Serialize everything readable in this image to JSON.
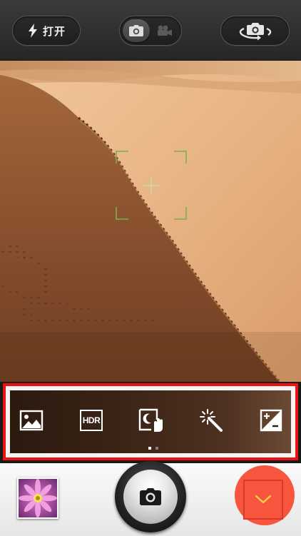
{
  "top_bar": {
    "flash": {
      "icon": "lightning-icon",
      "label": "打开"
    },
    "mode_toggle": {
      "photo_icon": "camera-icon",
      "video_icon": "video-camera-icon",
      "active": "photo"
    },
    "switch_camera_icon": "rotate-camera-icon"
  },
  "viewfinder": {
    "focus_icon": "focus-frame-icon"
  },
  "scene_modes": {
    "items": [
      {
        "icon": "landscape-icon"
      },
      {
        "label": "HDR",
        "icon": "hdr-icon"
      },
      {
        "icon": "night-handheld-icon"
      },
      {
        "icon": "magic-wand-icon"
      },
      {
        "icon": "exposure-icon"
      }
    ],
    "page_indicator": {
      "pages": 2,
      "current": 1
    }
  },
  "bottom_bar": {
    "gallery_thumbnail": "flower-photo",
    "shutter_icon": "camera-icon",
    "expand_icon": "chevron-down-icon"
  },
  "colors": {
    "highlight_border": "#ee1111",
    "accent": "#f7553d",
    "focus_frame": "#7ab04a"
  }
}
